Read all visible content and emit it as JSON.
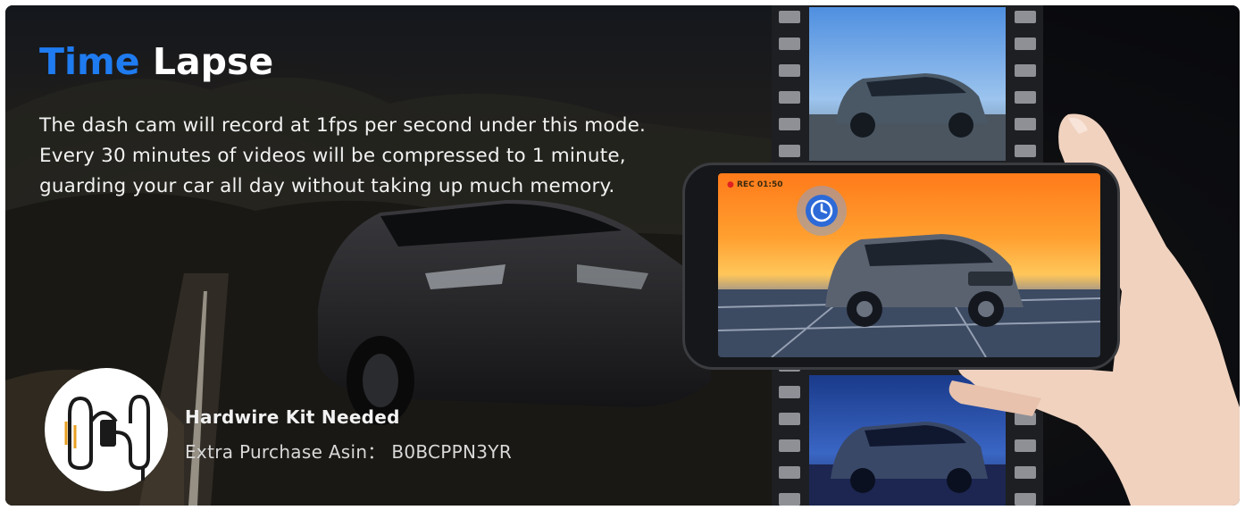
{
  "heading": {
    "word1": "Time",
    "word2": "Lapse"
  },
  "description": "The dash cam will record at 1fps per second under this mode. Every 30 minutes of videos will be compressed to 1 minute, guarding your car all day without taking up much memory.",
  "kit": {
    "title": "Hardwire Kit Needed",
    "subtitle": "Extra Purchase Asin： B0BCPPN3YR"
  },
  "phone": {
    "rec_label": "REC 01:50"
  },
  "icons": {
    "timer": "clock-icon",
    "kit": "hardwire-kit-icon"
  },
  "colors": {
    "accent": "#1f7bf0",
    "background": "#0c0d10",
    "text": "#ffffff"
  }
}
